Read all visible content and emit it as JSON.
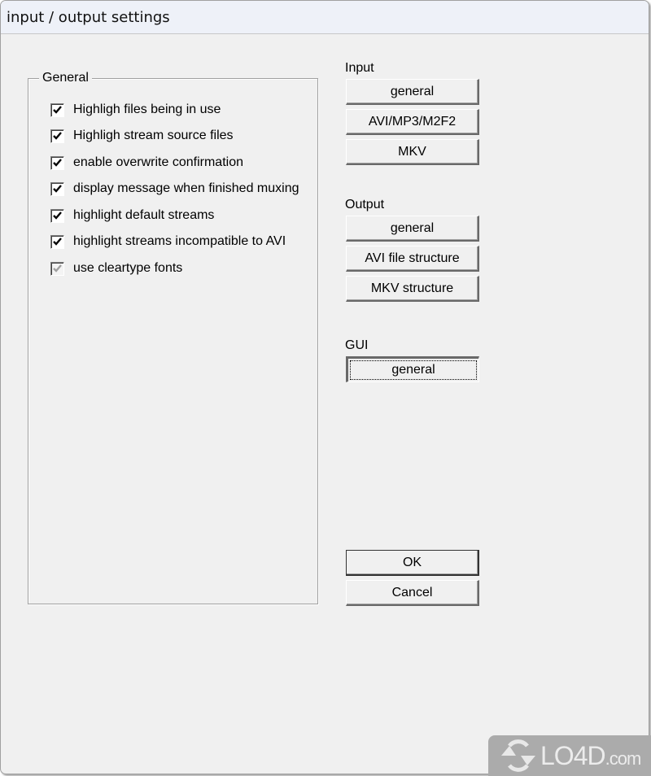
{
  "window": {
    "title": "input / output settings"
  },
  "general_group": {
    "legend": "General",
    "options": [
      {
        "label": "Highligh files being in use",
        "checked": true,
        "enabled": true
      },
      {
        "label": "Highligh stream source files",
        "checked": true,
        "enabled": true
      },
      {
        "label": "enable overwrite confirmation",
        "checked": true,
        "enabled": true
      },
      {
        "label": "display message when finished muxing",
        "checked": true,
        "enabled": true
      },
      {
        "label": "highlight default streams",
        "checked": true,
        "enabled": true
      },
      {
        "label": "highlight streams incompatible to AVI",
        "checked": true,
        "enabled": true
      },
      {
        "label": "use cleartype fonts",
        "checked": true,
        "enabled": false
      }
    ]
  },
  "input_section": {
    "label": "Input",
    "buttons": [
      "general",
      "AVI/MP3/M2F2",
      "MKV"
    ]
  },
  "output_section": {
    "label": "Output",
    "buttons": [
      "general",
      "AVI file structure",
      "MKV structure"
    ]
  },
  "gui_section": {
    "label": "GUI",
    "buttons": [
      "general"
    ]
  },
  "dialog_buttons": {
    "ok": "OK",
    "cancel": "Cancel"
  },
  "watermark": {
    "brand": "LO4D",
    "suffix": ".com"
  }
}
